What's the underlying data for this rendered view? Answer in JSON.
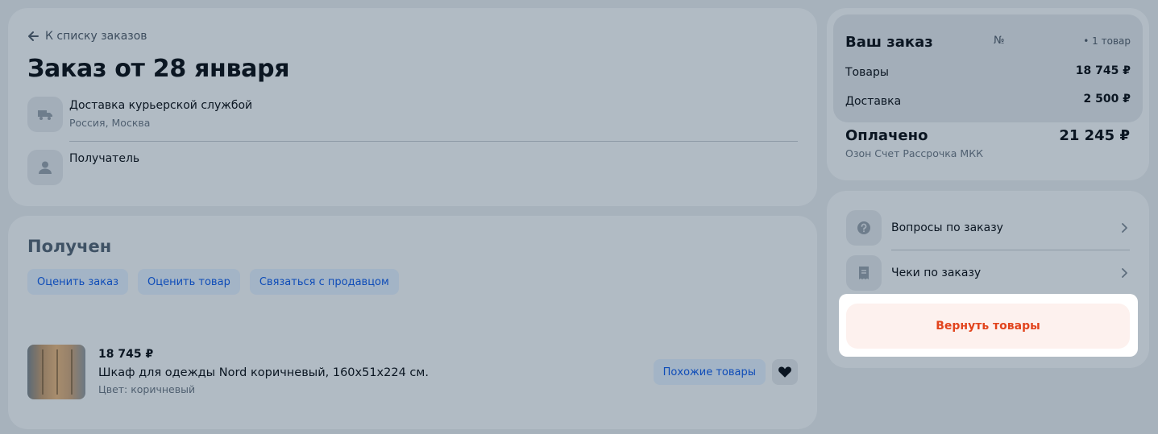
{
  "order": {
    "back_label": "К списку заказов",
    "title": "Заказ от 28 января",
    "delivery": {
      "main": "Доставка курьерской службой",
      "sub": "Россия, Москва",
      "icon": "truck-icon"
    },
    "recipient": {
      "main": "Получатель",
      "icon": "user-icon"
    }
  },
  "status": {
    "title": "Получен",
    "actions": [
      "Оценить заказ",
      "Оценить товар",
      "Связаться с продавцом"
    ]
  },
  "product": {
    "price": "18 745 ₽",
    "name": "Шкаф для одежды Nord коричневый, 160x51x224 см.",
    "color": "Цвет: коричневый",
    "similar_label": "Похожие товары",
    "favorite_icon": "heart-icon"
  },
  "summary": {
    "title": "Ваш заказ",
    "number_label": "№",
    "count": "• 1 товар",
    "items_label": "Товары",
    "items_value": "18 745 ₽",
    "delivery_label": "Доставка",
    "delivery_value": "2 500 ₽",
    "paid_label": "Оплачено",
    "paid_value": "21 245 ₽",
    "payment_method": "Озон Счет Рассрочка МКК"
  },
  "links": {
    "questions": {
      "label": "Вопросы по заказу",
      "icon": "question-icon"
    },
    "receipts": {
      "label": "Чеки по заказу",
      "icon": "receipt-icon"
    },
    "return_label": "Вернуть товары"
  },
  "colors": {
    "page_bg": "#a7b2bc",
    "card_bg": "#b1bbc4",
    "link_blue": "#0e4cb8",
    "return_red": "#e2441d"
  }
}
